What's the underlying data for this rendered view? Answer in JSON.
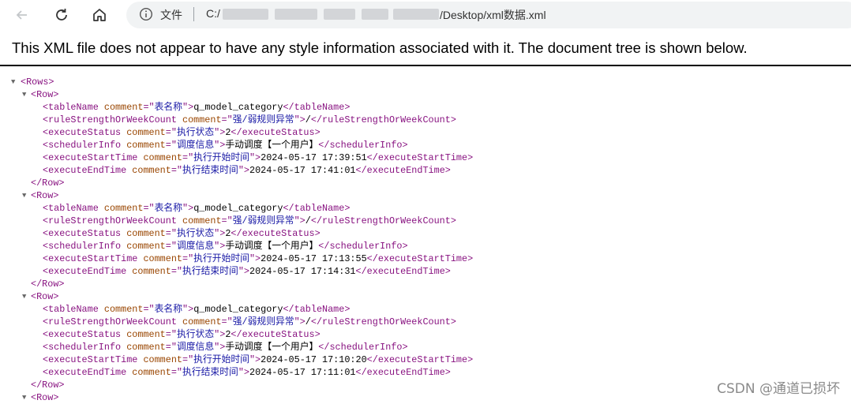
{
  "toolbar": {
    "file_label": "文件",
    "url_prefix": "C:/",
    "url_suffix": "/Desktop/xml数据.xml"
  },
  "xml_header": "This XML file does not appear to have any style information associated with it. The document tree is shown below.",
  "root_tag": "Rows",
  "rows": [
    {
      "tableName": {
        "comment": "表名称",
        "value": "q_model_category"
      },
      "ruleStrengthOrWeekCount": {
        "comment": "强/弱规则异常",
        "value": "/"
      },
      "executeStatus": {
        "comment": "执行状态",
        "value": "2"
      },
      "schedulerInfo": {
        "comment": "调度信息",
        "value": "手动调度【一个用户】"
      },
      "executeStartTime": {
        "comment": "执行开始时间",
        "value": "2024-05-17 17:39:51"
      },
      "executeEndTime": {
        "comment": "执行结束时间",
        "value": "2024-05-17 17:41:01"
      }
    },
    {
      "tableName": {
        "comment": "表名称",
        "value": "q_model_category"
      },
      "ruleStrengthOrWeekCount": {
        "comment": "强/弱规则异常",
        "value": "/"
      },
      "executeStatus": {
        "comment": "执行状态",
        "value": "2"
      },
      "schedulerInfo": {
        "comment": "调度信息",
        "value": "手动调度【一个用户】"
      },
      "executeStartTime": {
        "comment": "执行开始时间",
        "value": "2024-05-17 17:13:55"
      },
      "executeEndTime": {
        "comment": "执行结束时间",
        "value": "2024-05-17 17:14:31"
      }
    },
    {
      "tableName": {
        "comment": "表名称",
        "value": "q_model_category"
      },
      "ruleStrengthOrWeekCount": {
        "comment": "强/弱规则异常",
        "value": "/"
      },
      "executeStatus": {
        "comment": "执行状态",
        "value": "2"
      },
      "schedulerInfo": {
        "comment": "调度信息",
        "value": "手动调度【一个用户】"
      },
      "executeStartTime": {
        "comment": "执行开始时间",
        "value": "2024-05-17 17:10:20"
      },
      "executeEndTime": {
        "comment": "执行结束时间",
        "value": "2024-05-17 17:11:01"
      }
    }
  ],
  "watermark": "CSDN @通道已损坏",
  "colors": {
    "tag": "#881280",
    "attr": "#994500",
    "value": "#1a1aa6",
    "text": "#000000"
  }
}
